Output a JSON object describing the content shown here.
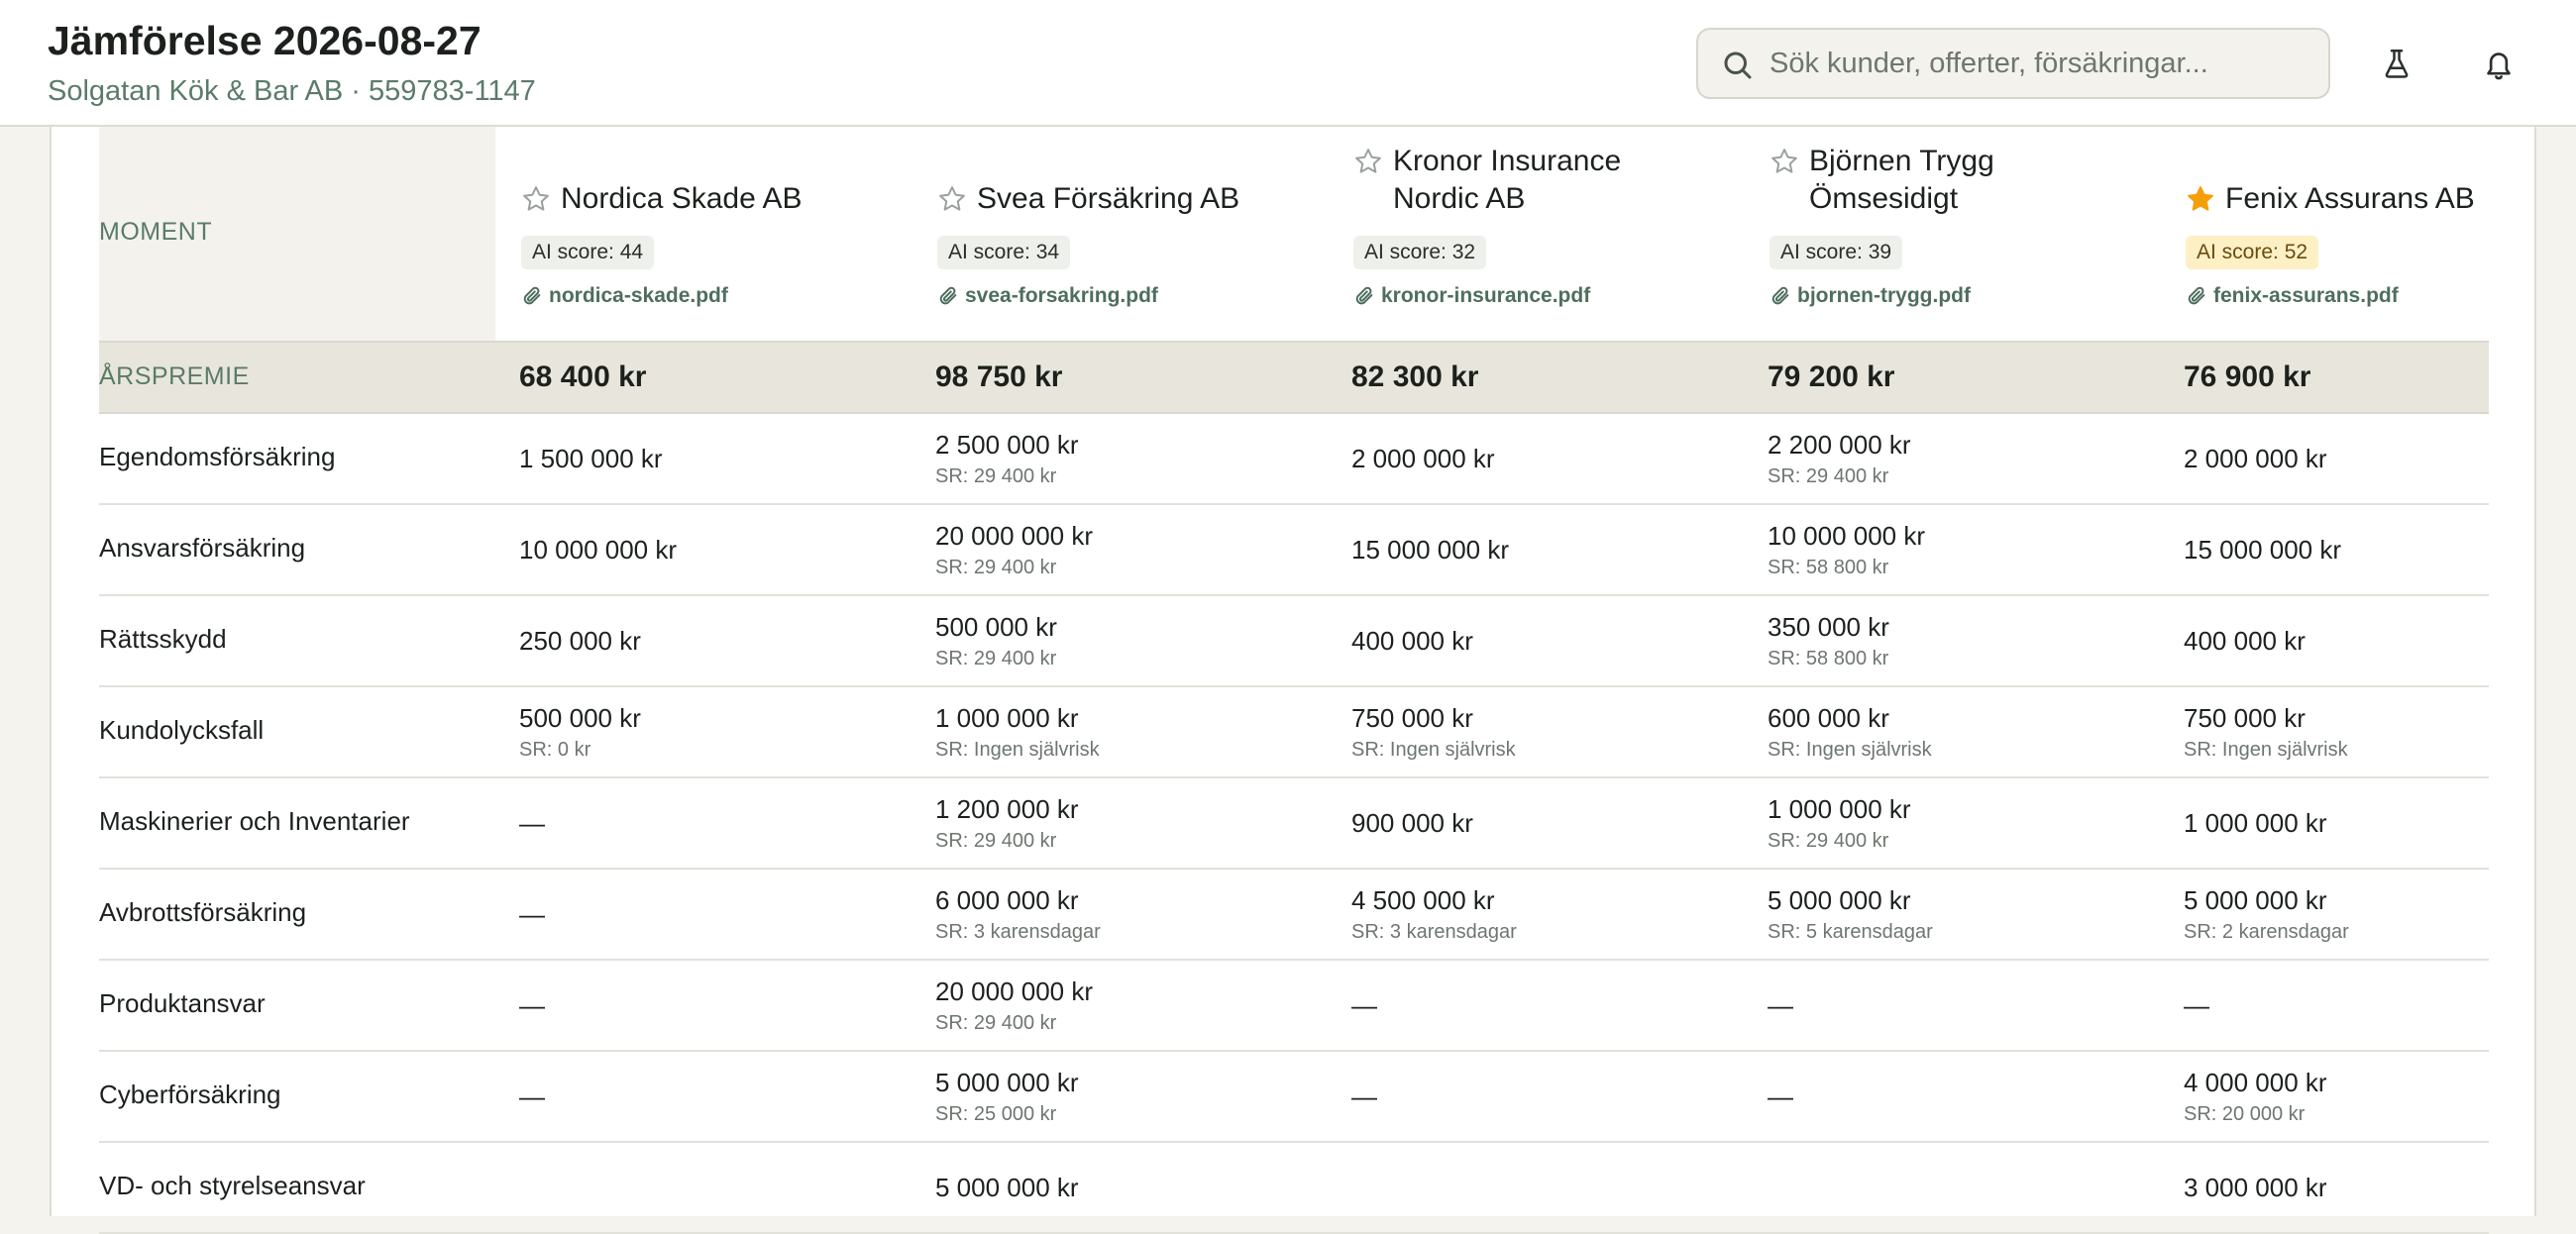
{
  "header": {
    "title": "Jämförelse 2026-08-27",
    "subtitle": "Solgatan Kök & Bar AB · 559783-1147",
    "search_placeholder": "Sök kunder, offerter, försäkringar...",
    "icons": {
      "search": "search-icon",
      "lab": "flask-icon",
      "notifications": "bell-icon"
    }
  },
  "colors": {
    "accent_star": "#f59e0b",
    "muted_green": "#5b7b6a",
    "premium_row_bg": "#e8e6dc"
  },
  "table": {
    "moment_header": "MOMENT",
    "insurers": [
      {
        "name_lines": [
          "Nordica Skade AB"
        ],
        "ai_score": "AI score: 44",
        "pdf": "nordica-skade.pdf",
        "starred": false
      },
      {
        "name_lines": [
          "Svea Försäkring AB"
        ],
        "ai_score": "AI score: 34",
        "pdf": "svea-forsakring.pdf",
        "starred": false
      },
      {
        "name_lines": [
          "Kronor Insurance",
          "Nordic AB"
        ],
        "ai_score": "AI score: 32",
        "pdf": "kronor-insurance.pdf",
        "starred": false
      },
      {
        "name_lines": [
          "Björnen Trygg",
          "Ömsesidigt"
        ],
        "ai_score": "AI score: 39",
        "pdf": "bjornen-trygg.pdf",
        "starred": false
      },
      {
        "name_lines": [
          "Fenix Assurans AB"
        ],
        "ai_score": "AI score: 52",
        "pdf": "fenix-assurans.pdf",
        "starred": true
      }
    ],
    "premium": {
      "label": "ÅRSPREMIE",
      "values": [
        "68 400 kr",
        "98 750 kr",
        "82 300 kr",
        "79 200 kr",
        "76 900 kr"
      ]
    },
    "rows": [
      {
        "label": "Egendomsförsäkring",
        "cells": [
          {
            "value": "1 500 000 kr",
            "sr": ""
          },
          {
            "value": "2 500 000 kr",
            "sr": "SR: 29 400 kr"
          },
          {
            "value": "2 000 000 kr",
            "sr": ""
          },
          {
            "value": "2 200 000 kr",
            "sr": "SR: 29 400 kr"
          },
          {
            "value": "2 000 000 kr",
            "sr": ""
          }
        ]
      },
      {
        "label": "Ansvarsförsäkring",
        "cells": [
          {
            "value": "10 000 000 kr",
            "sr": ""
          },
          {
            "value": "20 000 000 kr",
            "sr": "SR: 29 400 kr"
          },
          {
            "value": "15 000 000 kr",
            "sr": ""
          },
          {
            "value": "10 000 000 kr",
            "sr": "SR: 58 800 kr"
          },
          {
            "value": "15 000 000 kr",
            "sr": ""
          }
        ]
      },
      {
        "label": "Rättsskydd",
        "cells": [
          {
            "value": "250 000 kr",
            "sr": ""
          },
          {
            "value": "500 000 kr",
            "sr": "SR: 29 400 kr"
          },
          {
            "value": "400 000 kr",
            "sr": ""
          },
          {
            "value": "350 000 kr",
            "sr": "SR: 58 800 kr"
          },
          {
            "value": "400 000 kr",
            "sr": ""
          }
        ]
      },
      {
        "label": "Kundolycksfall",
        "cells": [
          {
            "value": "500 000 kr",
            "sr": "SR: 0 kr"
          },
          {
            "value": "1 000 000 kr",
            "sr": "SR: Ingen självrisk"
          },
          {
            "value": "750 000 kr",
            "sr": "SR: Ingen självrisk"
          },
          {
            "value": "600 000 kr",
            "sr": "SR: Ingen självrisk"
          },
          {
            "value": "750 000 kr",
            "sr": "SR: Ingen självrisk"
          }
        ]
      },
      {
        "label": "Maskinerier och Inventarier",
        "cells": [
          {
            "value": "—",
            "sr": ""
          },
          {
            "value": "1 200 000 kr",
            "sr": "SR: 29 400 kr"
          },
          {
            "value": "900 000 kr",
            "sr": ""
          },
          {
            "value": "1 000 000 kr",
            "sr": "SR: 29 400 kr"
          },
          {
            "value": "1 000 000 kr",
            "sr": ""
          }
        ]
      },
      {
        "label": "Avbrottsförsäkring",
        "cells": [
          {
            "value": "—",
            "sr": ""
          },
          {
            "value": "6 000 000 kr",
            "sr": "SR: 3 karensdagar"
          },
          {
            "value": "4 500 000 kr",
            "sr": "SR: 3 karensdagar"
          },
          {
            "value": "5 000 000 kr",
            "sr": "SR: 5 karensdagar"
          },
          {
            "value": "5 000 000 kr",
            "sr": "SR: 2 karensdagar"
          }
        ]
      },
      {
        "label": "Produktansvar",
        "cells": [
          {
            "value": "—",
            "sr": ""
          },
          {
            "value": "20 000 000 kr",
            "sr": "SR: 29 400 kr"
          },
          {
            "value": "—",
            "sr": ""
          },
          {
            "value": "—",
            "sr": ""
          },
          {
            "value": "—",
            "sr": ""
          }
        ]
      },
      {
        "label": "Cyberförsäkring",
        "cells": [
          {
            "value": "—",
            "sr": ""
          },
          {
            "value": "5 000 000 kr",
            "sr": "SR: 25 000 kr"
          },
          {
            "value": "—",
            "sr": ""
          },
          {
            "value": "—",
            "sr": ""
          },
          {
            "value": "4 000 000 kr",
            "sr": "SR: 20 000 kr"
          }
        ]
      },
      {
        "label": "VD- och styrelseansvar",
        "cells": [
          {
            "value": "",
            "sr": ""
          },
          {
            "value": "5 000 000 kr",
            "sr": ""
          },
          {
            "value": "",
            "sr": ""
          },
          {
            "value": "",
            "sr": ""
          },
          {
            "value": "3 000 000 kr",
            "sr": ""
          }
        ]
      }
    ]
  }
}
